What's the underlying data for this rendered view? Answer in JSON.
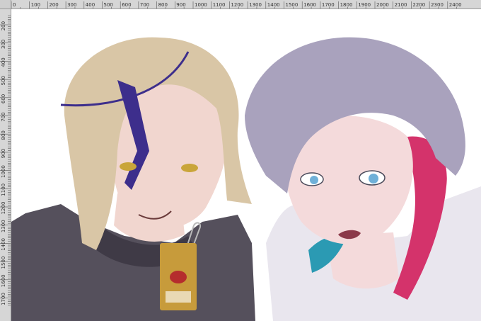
{
  "rulers": {
    "horizontal_labels": [
      "0",
      "100",
      "200",
      "300",
      "400",
      "500",
      "600",
      "700",
      "800",
      "900",
      "1000",
      "1100",
      "1200",
      "1300",
      "1400",
      "1500",
      "1600",
      "1700",
      "1800",
      "1900",
      "2000",
      "2100",
      "2200",
      "2300",
      "2400"
    ],
    "vertical_labels": [
      "200",
      "300",
      "400",
      "500",
      "600",
      "700",
      "800",
      "900",
      "1000",
      "1100",
      "1200",
      "1300",
      "1400",
      "1500",
      "1600",
      "1700"
    ]
  },
  "artwork": {
    "subject": "digital illustration in progress",
    "colors": {
      "left_hair": "#d9c6a6",
      "left_skin": "#f1d6cf",
      "left_clothes": "#55505c",
      "left_eye": "#c9a53a",
      "left_mark": "#3d2e8c",
      "right_hair": "#a9a2bd",
      "right_hair_red": "#d4336b",
      "right_hair_blue": "#2b9ab3",
      "right_skin": "#f4dadb",
      "right_eye": "#6fb0d8",
      "right_clothes": "#e9e6ee",
      "badge": "#c79b3b"
    }
  }
}
